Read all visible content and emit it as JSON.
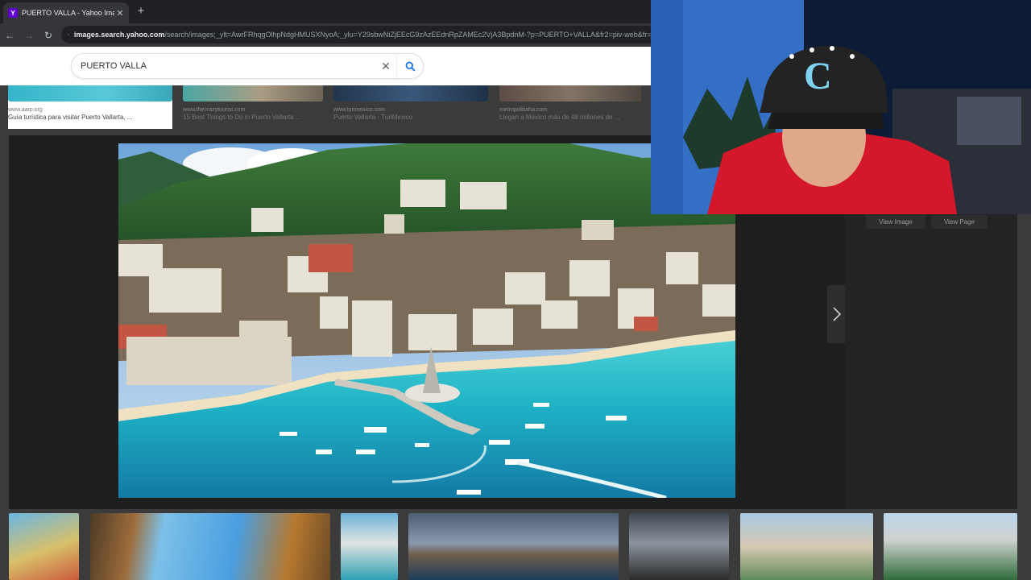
{
  "browser": {
    "tab_title": "PUERTO VALLA - Yahoo Image",
    "tab_favicon_letter": "Y",
    "tab_close": "✕",
    "new_tab": "+",
    "back": "←",
    "forward": "→",
    "reload": "↻",
    "url_host": "images.search.yahoo.com",
    "url_rest": "/search/images;_ylt=AwrFRhqgOlhpNdgHMUSXNyoA;_ylu=Y29sbwNiZjEEcG9zAzEEdnRpZAMEc2VjA3BpdnM-?p=PUERTO+VALLA&fr2=piv-web&fr=..."
  },
  "search": {
    "query": "PUERTO VALLA",
    "clear_icon": "✕"
  },
  "previous_results": [
    {
      "source": "www.aarp.org",
      "caption": "Guía turística para visitar Puerto Vallarta, ..."
    },
    {
      "source": "www.thecrazytourist.com",
      "caption": "15 Best Things to Do in Puerto Vallarta ..."
    },
    {
      "source": "www.turimexico.com",
      "caption": "Puerto Vallarta - TuriMexico"
    },
    {
      "source": "metropolitiaha.com",
      "caption": "Llegan a México más de 48 millones de ..."
    }
  ],
  "lightbox": {
    "view_image": "View Image",
    "view_page": "View Page"
  },
  "colors": {
    "yahoo_purple": "#6001d2",
    "search_blue": "#1a73e8",
    "lightbox_bg": "#1e1e1e"
  }
}
